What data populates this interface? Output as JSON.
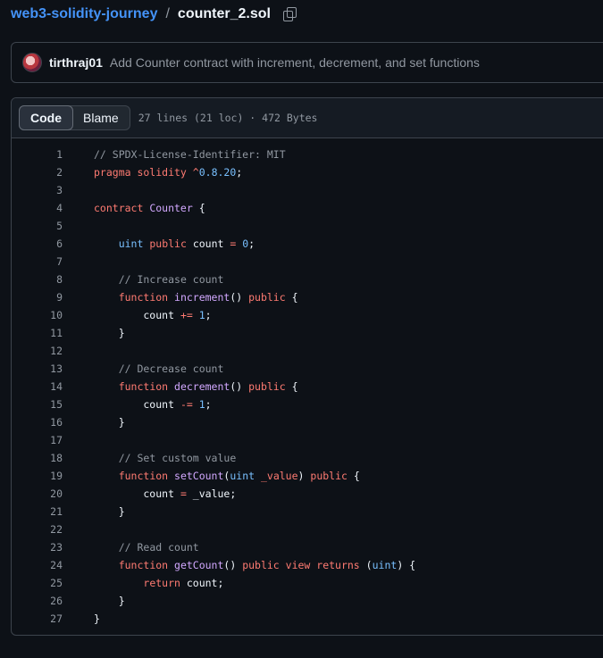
{
  "breadcrumb": {
    "repo": "web3-solidity-journey",
    "separator": "/",
    "file": "counter_2.sol"
  },
  "commit": {
    "author": "tirthraj01",
    "message": "Add Counter contract with increment, decrement, and set functions"
  },
  "file_header": {
    "tabs": [
      {
        "label": "Code",
        "active": true
      },
      {
        "label": "Blame",
        "active": false
      }
    ],
    "info": "27 lines (21 loc) · 472 Bytes"
  },
  "colors": {
    "comment": "#9198a1",
    "keyword": "#ff7b72",
    "type": "#79c0ff",
    "function": "#d2a8ff",
    "number": "#79c0ff"
  },
  "code_lines": [
    [
      [
        "comment",
        "// SPDX-License-Identifier: MIT"
      ]
    ],
    [
      [
        "keyword",
        "pragma solidity "
      ],
      [
        "keyword",
        "^"
      ],
      [
        "number",
        "0.8.20"
      ],
      [
        "plain",
        ";"
      ]
    ],
    [],
    [
      [
        "keyword",
        "contract "
      ],
      [
        "func",
        "Counter"
      ],
      [
        "plain",
        " {"
      ]
    ],
    [],
    [
      [
        "plain",
        "    "
      ],
      [
        "type",
        "uint"
      ],
      [
        "plain",
        " "
      ],
      [
        "keyword",
        "public"
      ],
      [
        "plain",
        " count "
      ],
      [
        "keyword",
        "="
      ],
      [
        "plain",
        " "
      ],
      [
        "number",
        "0"
      ],
      [
        "plain",
        ";"
      ]
    ],
    [],
    [
      [
        "plain",
        "    "
      ],
      [
        "comment",
        "// Increase count"
      ]
    ],
    [
      [
        "plain",
        "    "
      ],
      [
        "keyword",
        "function "
      ],
      [
        "func",
        "increment"
      ],
      [
        "plain",
        "() "
      ],
      [
        "keyword",
        "public"
      ],
      [
        "plain",
        " {"
      ]
    ],
    [
      [
        "plain",
        "        count "
      ],
      [
        "keyword",
        "+="
      ],
      [
        "plain",
        " "
      ],
      [
        "number",
        "1"
      ],
      [
        "plain",
        ";"
      ]
    ],
    [
      [
        "plain",
        "    }"
      ]
    ],
    [],
    [
      [
        "plain",
        "    "
      ],
      [
        "comment",
        "// Decrease count"
      ]
    ],
    [
      [
        "plain",
        "    "
      ],
      [
        "keyword",
        "function "
      ],
      [
        "func",
        "decrement"
      ],
      [
        "plain",
        "() "
      ],
      [
        "keyword",
        "public"
      ],
      [
        "plain",
        " {"
      ]
    ],
    [
      [
        "plain",
        "        count "
      ],
      [
        "keyword",
        "-="
      ],
      [
        "plain",
        " "
      ],
      [
        "number",
        "1"
      ],
      [
        "plain",
        ";"
      ]
    ],
    [
      [
        "plain",
        "    }"
      ]
    ],
    [],
    [
      [
        "plain",
        "    "
      ],
      [
        "comment",
        "// Set custom value"
      ]
    ],
    [
      [
        "plain",
        "    "
      ],
      [
        "keyword",
        "function "
      ],
      [
        "func",
        "setCount"
      ],
      [
        "plain",
        "("
      ],
      [
        "type",
        "uint"
      ],
      [
        "plain",
        " "
      ],
      [
        "keyword",
        "_value"
      ],
      [
        "plain",
        ") "
      ],
      [
        "keyword",
        "public"
      ],
      [
        "plain",
        " {"
      ]
    ],
    [
      [
        "plain",
        "        count "
      ],
      [
        "keyword",
        "="
      ],
      [
        "plain",
        " _value;"
      ]
    ],
    [
      [
        "plain",
        "    }"
      ]
    ],
    [],
    [
      [
        "plain",
        "    "
      ],
      [
        "comment",
        "// Read count"
      ]
    ],
    [
      [
        "plain",
        "    "
      ],
      [
        "keyword",
        "function "
      ],
      [
        "func",
        "getCount"
      ],
      [
        "plain",
        "() "
      ],
      [
        "keyword",
        "public view returns"
      ],
      [
        "plain",
        " ("
      ],
      [
        "type",
        "uint"
      ],
      [
        "plain",
        ") {"
      ]
    ],
    [
      [
        "plain",
        "        "
      ],
      [
        "keyword",
        "return"
      ],
      [
        "plain",
        " count;"
      ]
    ],
    [
      [
        "plain",
        "    }"
      ]
    ],
    [
      [
        "plain",
        "}"
      ]
    ]
  ]
}
